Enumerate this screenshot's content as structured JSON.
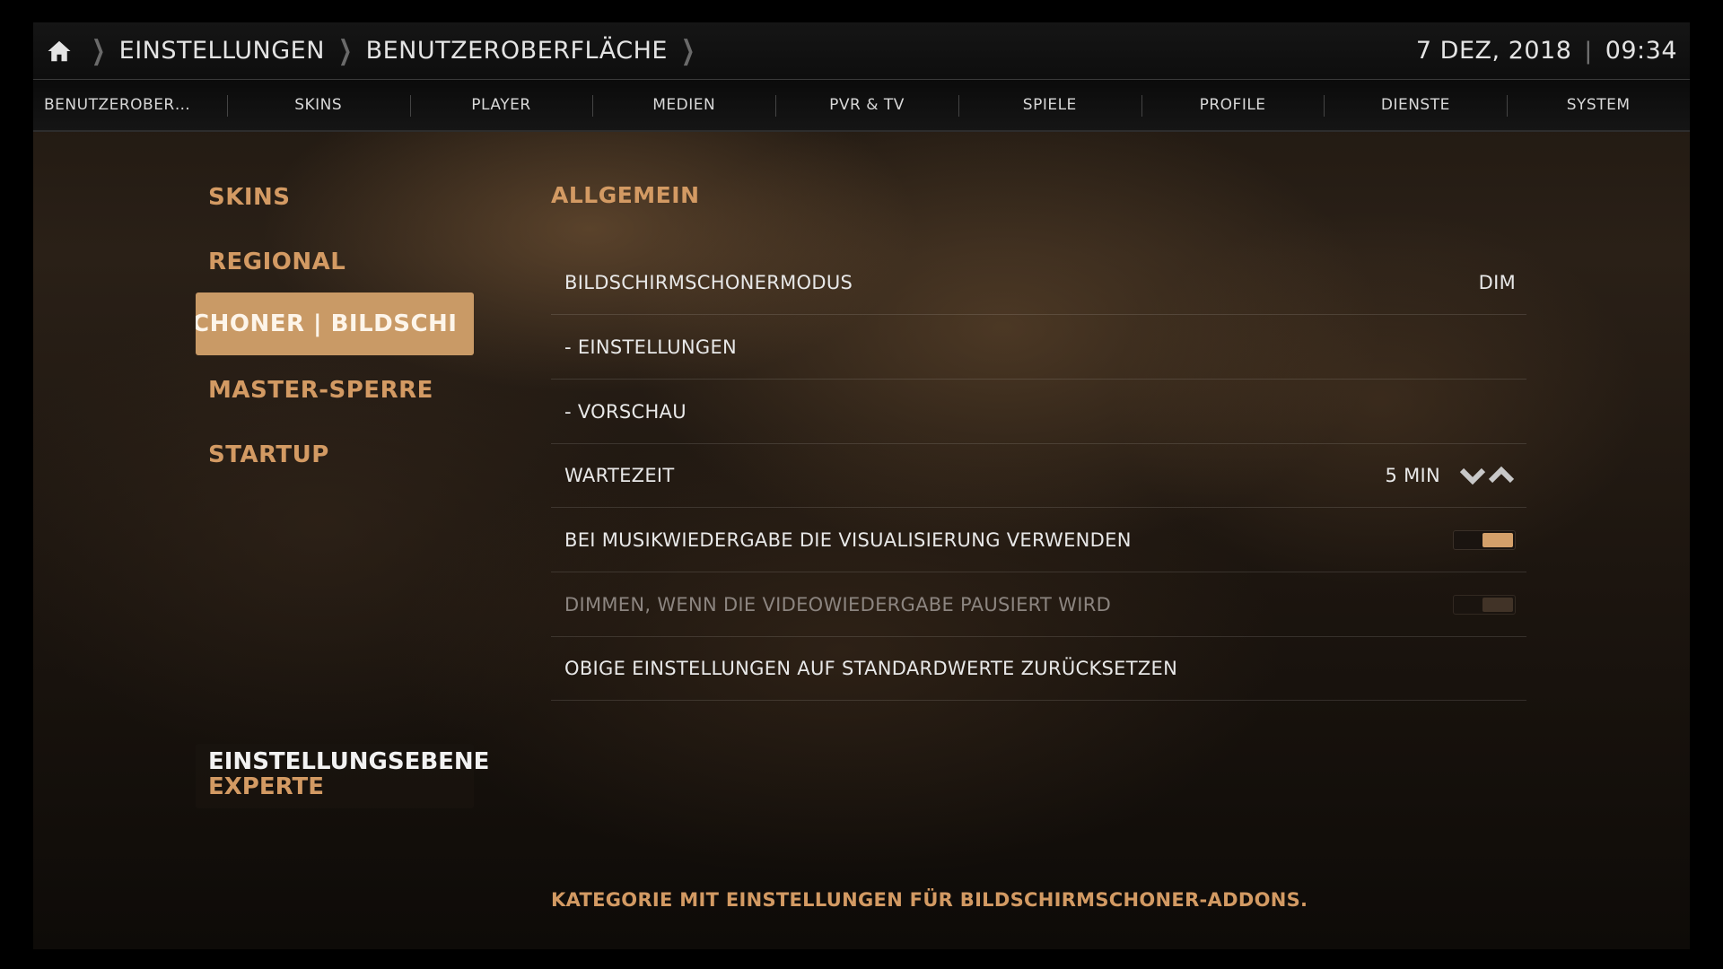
{
  "header": {
    "breadcrumbs": [
      "EINSTELLUNGEN",
      "BENUTZEROBERFLÄCHE"
    ],
    "date": "7 DEZ, 2018",
    "time": "09:34"
  },
  "tabs": [
    "BENUTZEROBER…",
    "SKINS",
    "PLAYER",
    "MEDIEN",
    "PVR & TV",
    "SPIELE",
    "PROFILE",
    "DIENSTE",
    "SYSTEM"
  ],
  "categories": [
    "SKINS",
    "REGIONAL",
    "CHONER | BILDSCHI",
    "MASTER-SPERRE",
    "STARTUP"
  ],
  "level": {
    "label": "EINSTELLUNGSEBENE",
    "value": "EXPERTE"
  },
  "section": {
    "title": "ALLGEMEIN"
  },
  "settings": [
    {
      "label": "BILDSCHIRMSCHONERMODUS",
      "value": "DIM"
    },
    {
      "label": "- EINSTELLUNGEN"
    },
    {
      "label": "- VORSCHAU"
    },
    {
      "label": "WARTEZEIT",
      "value": "5 MIN"
    },
    {
      "label": "BEI MUSIKWIEDERGABE DIE VISUALISIERUNG VERWENDEN",
      "toggle": true
    },
    {
      "label": "DIMMEN, WENN DIE VIDEOWIEDERGABE PAUSIERT WIRD",
      "toggle": false
    },
    {
      "label": "OBIGE EINSTELLUNGEN AUF STANDARDWERTE ZURÜCKSETZEN"
    }
  ],
  "description": "KATEGORIE MIT EINSTELLUNGEN FÜR BILDSCHIRMSCHONER-ADDONS.",
  "colors": {
    "accent": "#d39a63",
    "selected_bg": "#c99a66"
  }
}
